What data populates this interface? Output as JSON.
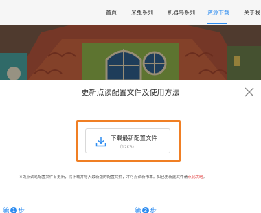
{
  "nav": {
    "items": [
      "首页",
      "米兔系列",
      "机器岛系列",
      "资源下载",
      "关于我"
    ],
    "active_index": 3,
    "active_color": "#2d8cf0"
  },
  "modal": {
    "title": "更新点读配置文件及使用方法",
    "download": {
      "label": "下载最新配置文件",
      "size": "（12KB）"
    },
    "notice": {
      "text": "※免点读笔配置文件有更新，需下载并导入最新版的配置文件，才可点读新书本。如已更新此文件请",
      "link": "点此跳略"
    },
    "steps": [
      {
        "prefix": "第",
        "num": "1",
        "suffix": "步"
      },
      {
        "prefix": "第",
        "num": "2",
        "suffix": "步"
      }
    ],
    "highlight_color": "#f07f24"
  }
}
